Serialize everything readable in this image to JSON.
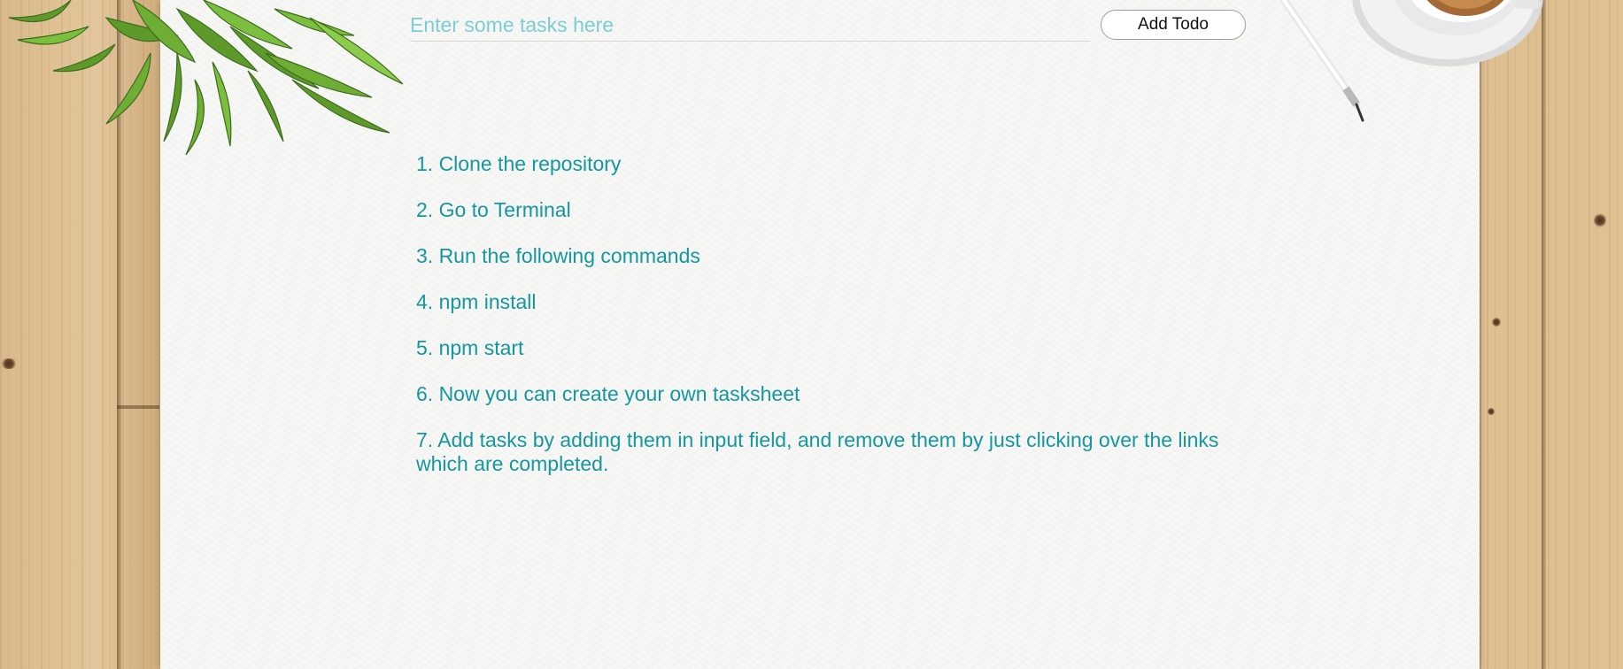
{
  "form": {
    "input_value": "",
    "input_placeholder": "Enter some tasks here",
    "add_button_label": "Add Todo"
  },
  "tasks": [
    {
      "text": "1. Clone the repository"
    },
    {
      "text": "2. Go to Terminal"
    },
    {
      "text": "3. Run the following commands"
    },
    {
      "text": "4. npm install"
    },
    {
      "text": "5. npm start"
    },
    {
      "text": "6. Now you can create your own tasksheet"
    },
    {
      "text": "7. Add tasks by adding them in input field, and remove them by just clicking over the links which are completed."
    }
  ],
  "decorations": [
    "plant-image",
    "pen-image",
    "coffee-cup-image"
  ],
  "colors": {
    "task_text": "#15979e",
    "placeholder": "#7ccdd3",
    "paper": "#f7f7f6",
    "wood": "#dfc194"
  }
}
